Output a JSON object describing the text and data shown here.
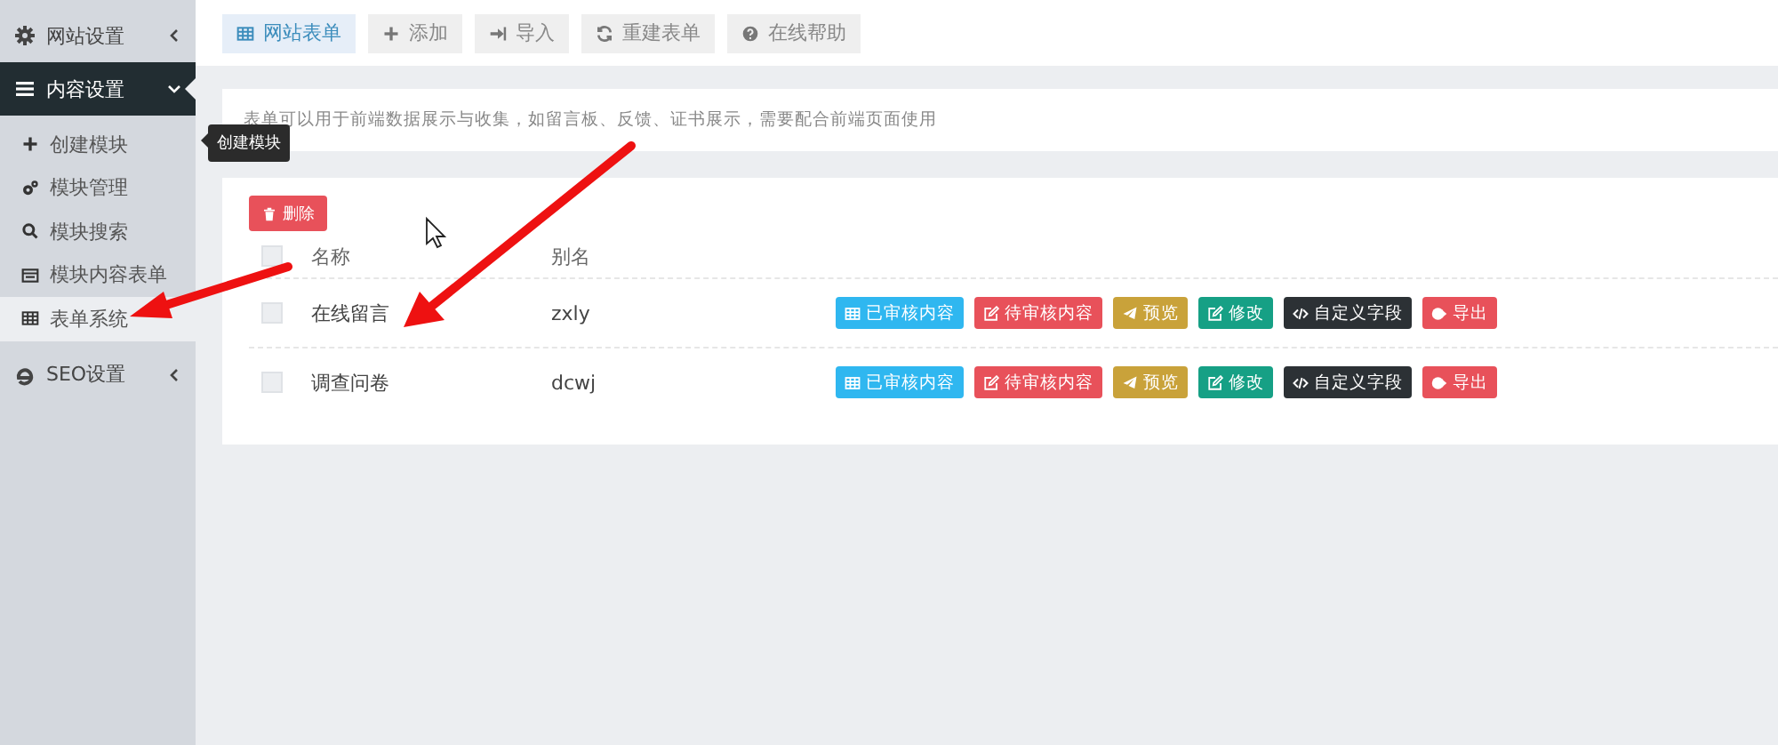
{
  "sidebar": {
    "groups": [
      {
        "label": "网站设置",
        "expanded": false
      },
      {
        "label": "内容设置",
        "expanded": true,
        "children": [
          {
            "label": "创建模块",
            "selected": false
          },
          {
            "label": "模块管理",
            "selected": false
          },
          {
            "label": "模块搜索",
            "selected": false
          },
          {
            "label": "模块内容表单",
            "selected": false
          },
          {
            "label": "表单系统",
            "selected": true
          }
        ]
      },
      {
        "label": "SEO设置",
        "expanded": false
      }
    ]
  },
  "tooltip": "创建模块",
  "toolbar": [
    {
      "label": "网站表单",
      "selected": true
    },
    {
      "label": "添加",
      "selected": false
    },
    {
      "label": "导入",
      "selected": false
    },
    {
      "label": "重建表单",
      "selected": false
    },
    {
      "label": "在线帮助",
      "selected": false
    }
  ],
  "info": "表单可以用于前端数据展示与收集，如留言板、反馈、证书展示，需要配合前端页面使用",
  "delete_button": "删除",
  "table": {
    "columns": [
      "名称",
      "别名"
    ],
    "header_checked": false,
    "rows": [
      {
        "name": "在线留言",
        "alias": "zxly",
        "checked": false,
        "actions": [
          {
            "label": "已审核内容",
            "kind": "info"
          },
          {
            "label": "待审核内容",
            "kind": "danger"
          },
          {
            "label": "预览",
            "kind": "warning"
          },
          {
            "label": "修改",
            "kind": "success"
          },
          {
            "label": "自定义字段",
            "kind": "dark"
          },
          {
            "label": "导出",
            "kind": "danger"
          }
        ]
      },
      {
        "name": "调查问卷",
        "alias": "dcwj",
        "checked": false,
        "actions": [
          {
            "label": "已审核内容",
            "kind": "info"
          },
          {
            "label": "待审核内容",
            "kind": "danger"
          },
          {
            "label": "预览",
            "kind": "warning"
          },
          {
            "label": "修改",
            "kind": "success"
          },
          {
            "label": "自定义字段",
            "kind": "dark"
          },
          {
            "label": "导出",
            "kind": "danger"
          }
        ]
      }
    ]
  }
}
